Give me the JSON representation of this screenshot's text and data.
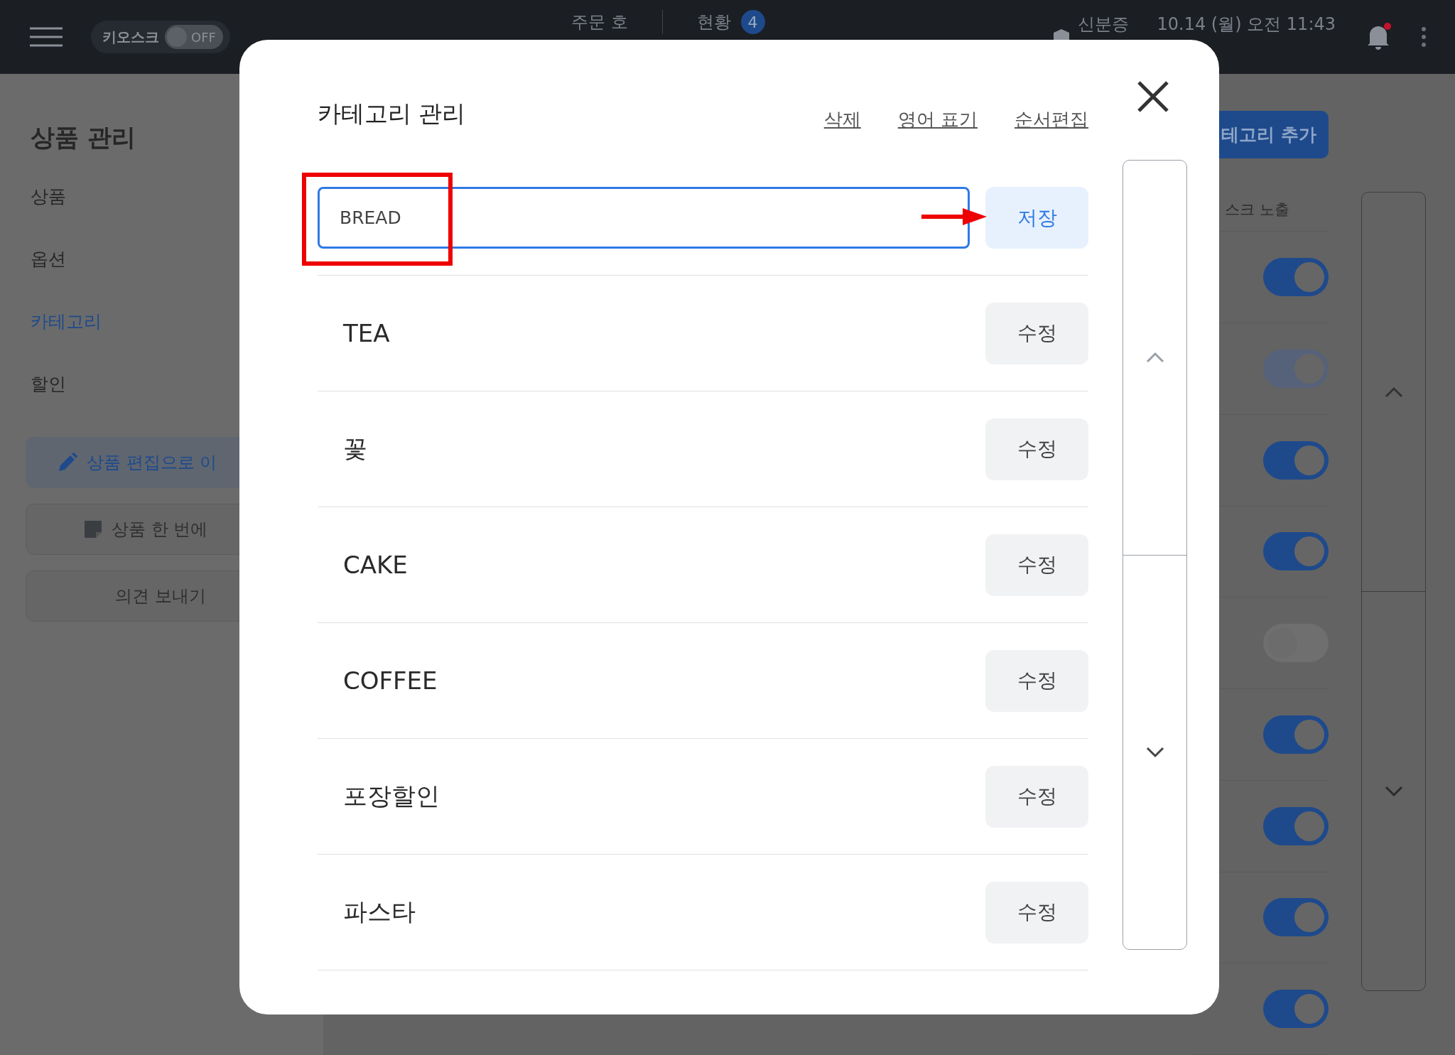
{
  "top_bar": {
    "kiosk_label": "키오스크",
    "kiosk_toggle": {
      "label": "OFF",
      "on": false
    },
    "nav": [
      {
        "label": "주문 호"
      },
      {
        "label": "현황",
        "badge": "4"
      }
    ],
    "id_label": "신분증",
    "datetime": "10.14 (월) 오전 11:43",
    "notification": true
  },
  "sidebar": {
    "title": "상품 관리",
    "items": [
      {
        "label": "상품",
        "selected": false
      },
      {
        "label": "옵션",
        "selected": false
      },
      {
        "label": "카테고리",
        "selected": true
      },
      {
        "label": "할인",
        "selected": false
      }
    ],
    "buttons": [
      {
        "kind": "edit",
        "label": "상품 편집으로 이"
      },
      {
        "kind": "excel",
        "label": "상품 한 번에"
      },
      {
        "kind": "plain",
        "label": "의견 보내기"
      }
    ]
  },
  "main": {
    "add_button": "테고리 추가",
    "column_header": "스크 노출",
    "toggles": [
      {
        "on": true,
        "disabled": false
      },
      {
        "on": true,
        "disabled": true
      },
      {
        "on": true,
        "disabled": false
      },
      {
        "on": true,
        "disabled": false
      },
      {
        "on": false,
        "disabled": true
      },
      {
        "on": true,
        "disabled": false
      },
      {
        "on": true,
        "disabled": false
      },
      {
        "on": true,
        "disabled": false
      },
      {
        "on": true,
        "disabled": false
      }
    ]
  },
  "modal": {
    "title": "카테고리 관리",
    "links": [
      "삭제",
      "영어 표기",
      "순서편집"
    ],
    "input": {
      "value": "BREAD"
    },
    "save_button": "저장",
    "categories": [
      {
        "name": "TEA",
        "button": "수정"
      },
      {
        "name": "꽃",
        "button": "수정"
      },
      {
        "name": "CAKE",
        "button": "수정"
      },
      {
        "name": "COFFEE",
        "button": "수정"
      },
      {
        "name": "포장할인",
        "button": "수정"
      },
      {
        "name": "파스타",
        "button": "수정"
      }
    ]
  }
}
